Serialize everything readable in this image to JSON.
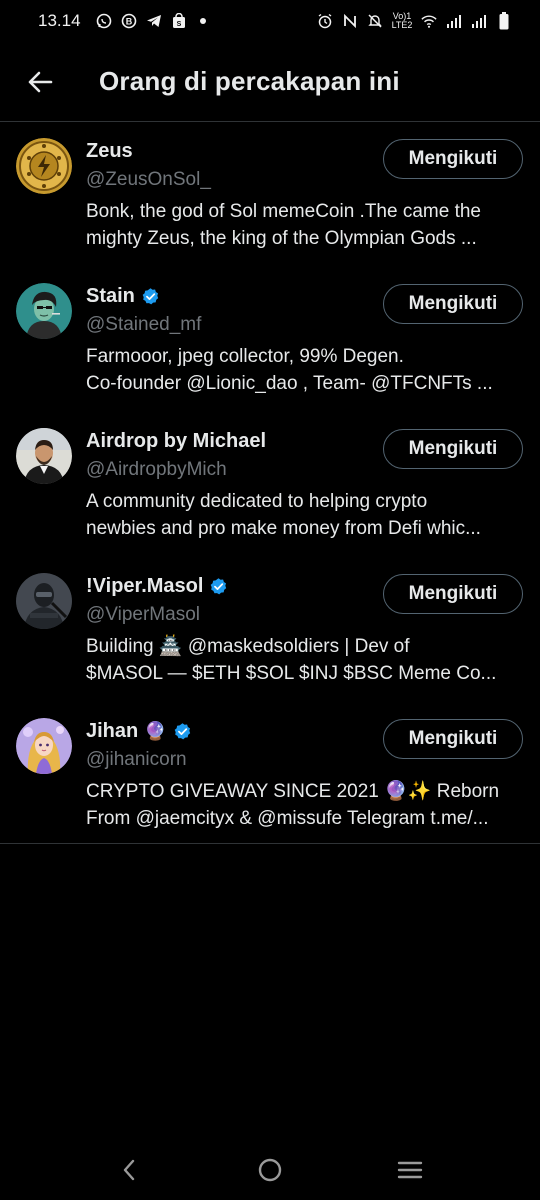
{
  "status_bar": {
    "time": "13.14",
    "network_label_top": "Vo)1",
    "network_label_bottom": "LTE2",
    "icons": [
      "whatsapp-icon",
      "b-app-icon",
      "telegram-icon",
      "shop-bag-icon",
      "dot-icon",
      "alarm-icon",
      "nfc-icon",
      "mute-icon",
      "volte-icon",
      "wifi-icon",
      "signal-1-icon",
      "signal-2-icon",
      "battery-icon"
    ]
  },
  "header": {
    "title": "Orang di percakapan ini"
  },
  "people": [
    {
      "name": "Zeus",
      "handle": "@ZeusOnSol_",
      "verified": false,
      "emoji": "",
      "bio_line1": "Bonk, the god of Sol memeCoin .The came the",
      "bio_line2": "mighty Zeus, the king of the Olympian Gods ...",
      "button": "Mengikuti"
    },
    {
      "name": "Stain",
      "handle": "@Stained_mf",
      "verified": true,
      "emoji": "",
      "bio_line1": "Farmooor, jpeg collector, 99% Degen.",
      "bio_line2": "Co-founder @Lionic_dao , Team- @TFCNFTs ...",
      "button": "Mengikuti"
    },
    {
      "name": "Airdrop by Michael",
      "handle": "@AirdropbyMich",
      "verified": false,
      "emoji": "",
      "bio_line1": "A community dedicated to helping crypto",
      "bio_line2": "newbies and pro make money from Defi whic...",
      "button": "Mengikuti"
    },
    {
      "name": "!Viper.Masol",
      "handle": "@ViperMasol",
      "verified": true,
      "emoji": "",
      "bio_line1": "Building 🏯 @maskedsoldiers | Dev of",
      "bio_line2": "$MASOL — $ETH $SOL $INJ $BSC Meme Co...",
      "button": "Mengikuti"
    },
    {
      "name": "Jihan",
      "handle": "@jihanicorn",
      "verified": true,
      "emoji": "🔮",
      "bio_line1": "CRYPTO GIVEAWAY SINCE 2021 🔮✨ Reborn",
      "bio_line2": "From @jaemcityx & @missufe Telegram t.me/...",
      "button": "Mengikuti"
    }
  ],
  "colors": {
    "background": "#000000",
    "text_primary": "#e7e9ea",
    "text_secondary": "#71767b",
    "verified_blue": "#1d9bf0",
    "divider": "#2f3336",
    "button_border": "#536471"
  },
  "nav_bar": {
    "icons": [
      "back-nav-icon",
      "home-nav-icon",
      "recents-nav-icon"
    ]
  }
}
